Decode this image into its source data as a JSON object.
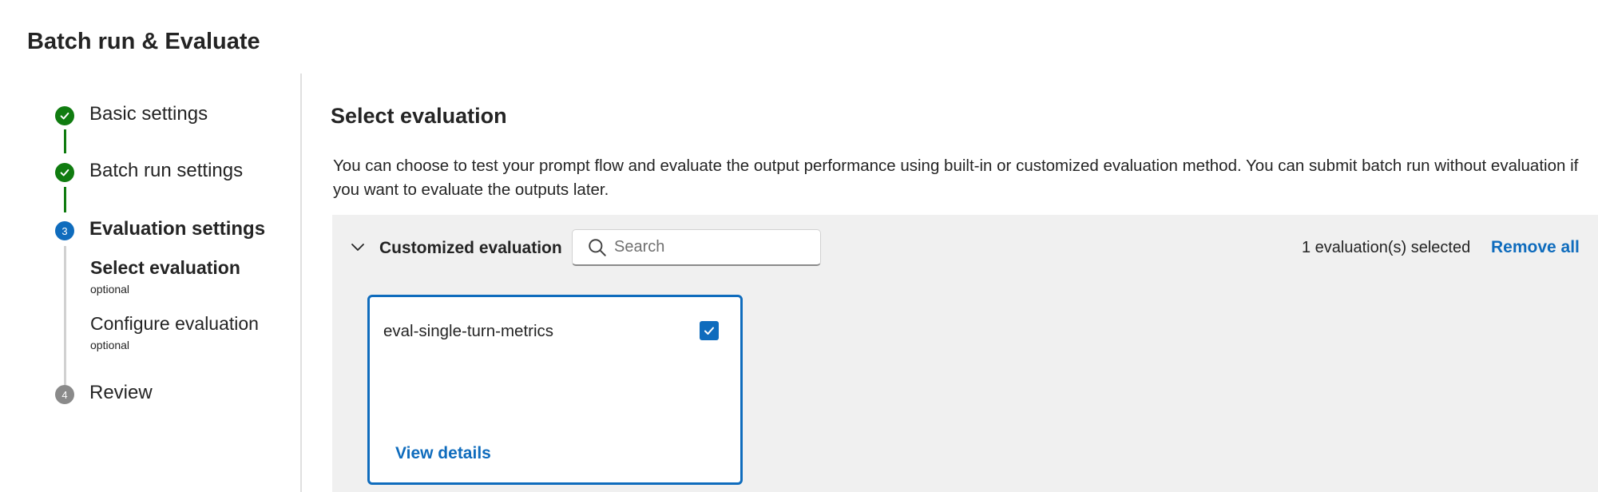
{
  "dialog": {
    "title": "Batch run & Evaluate"
  },
  "stepper": {
    "steps": [
      {
        "number": "1",
        "label": "Basic settings",
        "status": "completed"
      },
      {
        "number": "2",
        "label": "Batch run settings",
        "status": "completed"
      },
      {
        "number": "3",
        "label": "Evaluation settings",
        "status": "current"
      },
      {
        "number": "4",
        "label": "Review",
        "status": "pending"
      }
    ],
    "substeps": [
      {
        "label": "Select evaluation",
        "optional": "optional",
        "active": true
      },
      {
        "label": "Configure evaluation",
        "optional": "optional",
        "active": false
      }
    ]
  },
  "main": {
    "section_title": "Select evaluation",
    "description": "You can choose to test your prompt flow and evaluate the output performance using built-in or customized evaluation method. You can submit batch run without evaluation if you want to evaluate the outputs later."
  },
  "panel": {
    "heading": "Customized evaluation",
    "search_placeholder": "Search",
    "search_value": "",
    "selected_count": "1 evaluation(s) selected",
    "remove_all": "Remove all",
    "cards": [
      {
        "title": "eval-single-turn-metrics",
        "checked": true,
        "link": "View details"
      }
    ]
  },
  "colors": {
    "accent": "#0f6cbd",
    "success": "#107c10",
    "pending": "#8a8a8a",
    "panel_bg": "#f0f0f0"
  },
  "icons": {
    "completed_step": "checkmark-circle-icon",
    "collapse": "chevron-down-icon",
    "search": "search-icon",
    "checkbox": "checkmark-icon"
  }
}
